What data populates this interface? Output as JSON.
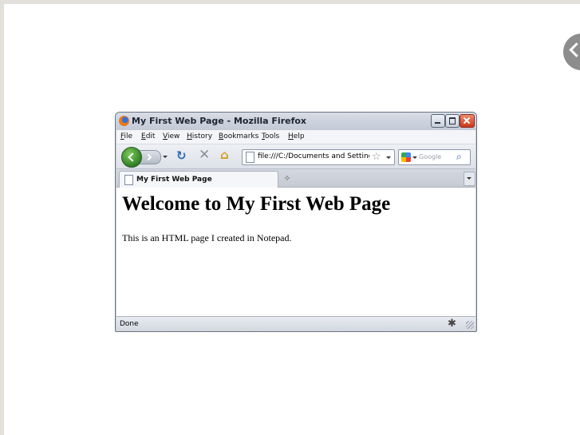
{
  "window": {
    "title": "My First Web Page - Mozilla Firefox"
  },
  "menubar": {
    "items": [
      "File",
      "Edit",
      "View",
      "History",
      "Bookmarks",
      "Tools",
      "Help"
    ]
  },
  "navbar": {
    "url": "file:///C:/Documents and Settings/J",
    "search_placeholder": "Google",
    "icons": [
      "back-icon",
      "forward-icon",
      "reload-icon",
      "stop-icon",
      "home-icon",
      "bookmark-star-icon",
      "search-icon"
    ]
  },
  "tabs": [
    {
      "label": "My First Web Page"
    }
  ],
  "page": {
    "heading": "Welcome to My First Web Page",
    "paragraph": "This is an HTML page I created in Notepad."
  },
  "statusbar": {
    "text": "Done"
  },
  "colors": {
    "background": "#e3e0dc",
    "close_button": "#c8371b",
    "back_button": "#2a7a22"
  }
}
